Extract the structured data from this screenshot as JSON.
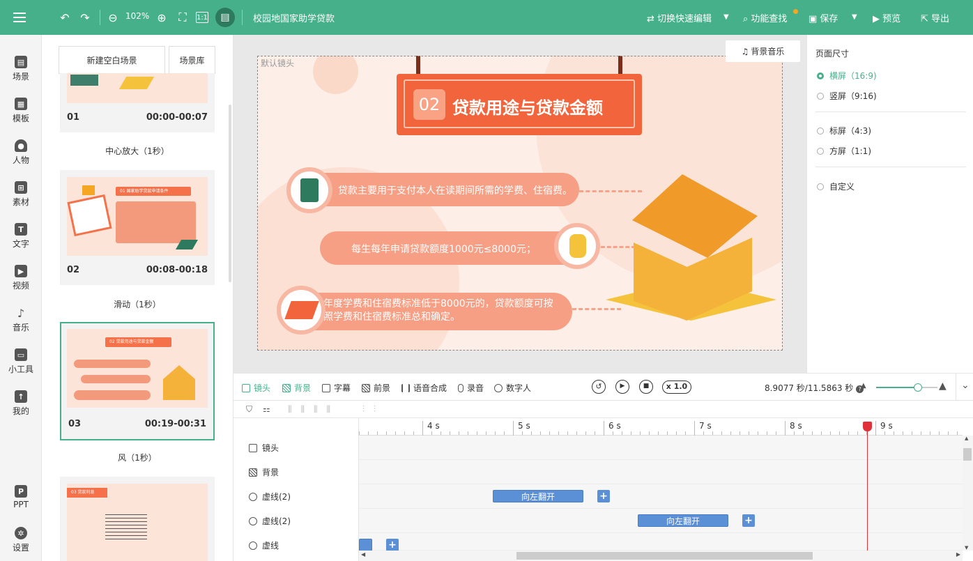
{
  "topbar": {
    "zoom": "102%",
    "ratio_icon": "1:1",
    "doc_title": "校园地国家助学贷款",
    "switch_edit": "切换快速编辑",
    "find": "功能查找",
    "save": "保存",
    "preview": "预览",
    "export": "导出"
  },
  "nav": [
    {
      "label": "场景"
    },
    {
      "label": "模板"
    },
    {
      "label": "人物"
    },
    {
      "label": "素材"
    },
    {
      "label": "文字"
    },
    {
      "label": "视频"
    },
    {
      "label": "音乐"
    },
    {
      "label": "小工具"
    },
    {
      "label": "我的"
    },
    {
      "label": "PPT"
    },
    {
      "label": "设置"
    }
  ],
  "scenes": {
    "new_blank": "新建空白场景",
    "library": "场景库",
    "cards": [
      {
        "num": "01",
        "time": "00:00-00:07",
        "transition": "中心放大（1秒）"
      },
      {
        "num": "02",
        "time": "00:08-00:18",
        "transition": "滑动（1秒）"
      },
      {
        "num": "03",
        "time": "00:19-00:31",
        "transition": "风（1秒）"
      }
    ],
    "thumb2_title": "01 国家助学贷款申请条件",
    "thumb3_title": "02 贷款用途与贷款金额",
    "thumb4_title": "03 贷款利息"
  },
  "canvas": {
    "camera_label": "默认镜头",
    "bg_music": "背景音乐",
    "heading_num": "02",
    "heading": "贷款用途与贷款金额",
    "item1": "贷款主要用于支付本人在读期间所需的学费、住宿费。",
    "item2": "每生每年申请贷款额度1000元≤8000元；",
    "item3_line1": "年度学费和住宿费标准低于8000元的，贷款额度可按",
    "item3_line2": "照学费和住宿费标准总和确定。"
  },
  "page_size": {
    "title": "页面尺寸",
    "options": [
      {
        "label": "横屏（16:9)"
      },
      {
        "label": "竖屏（9:16)"
      },
      {
        "label": "标屏（4:3)"
      },
      {
        "label": "方屏（1:1)"
      },
      {
        "label": "自定义"
      }
    ],
    "selected": "横屏（16:9)"
  },
  "toolbar": {
    "camera": "镜头",
    "background": "背景",
    "subtitle": "字幕",
    "foreground": "前景",
    "tts": "语音合成",
    "record": "录音",
    "digital_human": "数字人",
    "speed": "x 1.0",
    "time": "8.9077 秒/11.5863 秒",
    "zoom_fraction": 0.68
  },
  "timeline": {
    "ticks": [
      "4 s",
      "5 s",
      "6 s",
      "7 s",
      "8 s",
      "9 s"
    ],
    "tracks": [
      {
        "label": "镜头"
      },
      {
        "label": "背景"
      },
      {
        "label": "虚线(2)"
      },
      {
        "label": "虚线(2)"
      },
      {
        "label": "虚线"
      }
    ],
    "clip_flip_left": "向左翻开",
    "clip_flip_left2": "向左翻开",
    "playhead_s": 8.9077
  }
}
